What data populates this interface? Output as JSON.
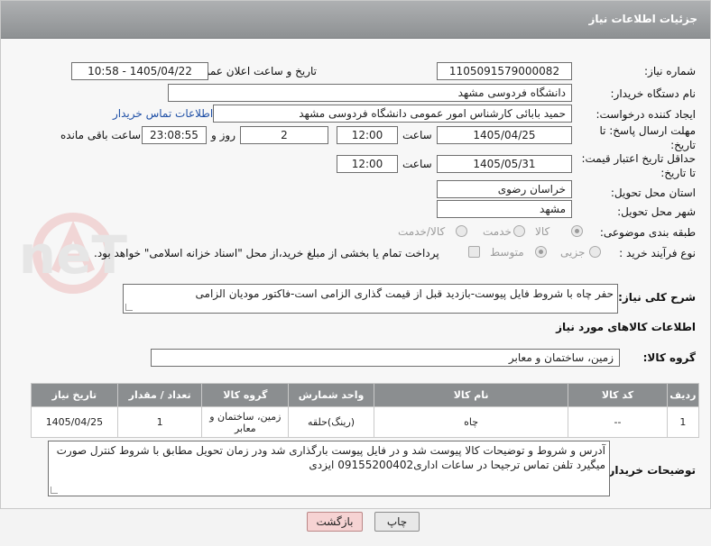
{
  "header": {
    "title": "جزئیات اطلاعات نیاز"
  },
  "fields": {
    "need_number": {
      "label": "شماره نیاز:",
      "value": "1105091579000082"
    },
    "announce_date": {
      "label": "تاریخ و ساعت اعلان عمومی:",
      "value": "1405/04/22 - 10:58"
    },
    "buyer_org": {
      "label": "نام دستگاه خریدار:",
      "value": "دانشگاه فردوسی مشهد"
    },
    "requester": {
      "label": "ایجاد کننده درخواست:",
      "value": "حمید بابائی کارشناس امور عمومی دانشگاه فردوسی مشهد",
      "contact_link": "اطلاعات تماس خریدار"
    },
    "deadline": {
      "label": "مهلت ارسال پاسخ: تا تاریخ:",
      "date": "1405/04/25",
      "time_label": "ساعت",
      "time": "12:00",
      "days": "2",
      "days_label": "روز و",
      "remaining": "23:08:55",
      "remaining_label": "ساعت باقی مانده"
    },
    "validity": {
      "label": "حداقل تاریخ اعتبار قیمت: تا تاریخ:",
      "date": "1405/05/31",
      "time_label": "ساعت",
      "time": "12:00"
    },
    "province": {
      "label": "استان محل تحویل:",
      "value": "خراسان رضوی"
    },
    "city": {
      "label": "شهر محل تحویل:",
      "value": "مشهد"
    },
    "category": {
      "label": "طبقه بندی موضوعی:",
      "options": [
        "کالا",
        "خدمت",
        "کالا/خدمت"
      ],
      "selected": "کالا"
    },
    "process": {
      "label": "نوع فرآیند خرید :",
      "options": [
        "جزیی",
        "متوسط"
      ],
      "selected": "متوسط",
      "payment_note": "پرداخت تمام یا بخشی از مبلغ خرید،از محل \"اسناد خزانه اسلامی\" خواهد بود."
    }
  },
  "description": {
    "label": "شرح کلی نیاز:",
    "value": "حفر چاه با شروط فایل پیوست-بازدید قبل از قیمت گذاری الزامی است-فاکتور مودیان الزامی"
  },
  "goods_info": {
    "title": "اطلاعات کالاهای مورد نیاز"
  },
  "goods_group": {
    "label": "گروه کالا:",
    "value": "زمین، ساختمان و معابر"
  },
  "table": {
    "headers": [
      "ردیف",
      "کد کالا",
      "نام کالا",
      "واحد شمارش",
      "گروه کالا",
      "تعداد / مقدار",
      "تاریخ نیاز"
    ],
    "rows": [
      {
        "row": "1",
        "code": "--",
        "name": "چاه",
        "unit": "(رینگ)حلقه",
        "group": "زمین، ساختمان و معابر",
        "qty": "1",
        "date": "1405/04/25"
      }
    ]
  },
  "buyer_notes": {
    "label": "توضیحات خریدار:",
    "line1": "آدرس و شروط  و توضیحات کالا پیوست شد و در فایل پیوست بارگذاری شد ودر زمان تحویل مطابق با شروط کنترل صورت",
    "line2": "میگیرد تلفن تماس  ترجیحا در ساعات اداری09155200402 ایزدی"
  },
  "buttons": {
    "print": "چاپ",
    "back": "بازگشت"
  },
  "colors": {
    "header": "#8e9193",
    "link": "#1e4fa6",
    "back_button": "#f6d3d3",
    "print_button": "#e8e8e8"
  },
  "watermark": {
    "text": "AriaTender.neT"
  }
}
